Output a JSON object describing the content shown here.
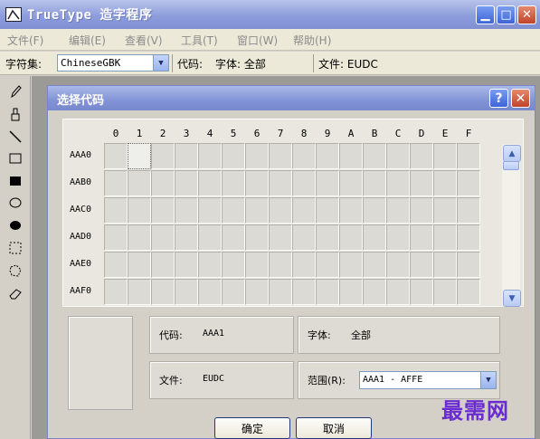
{
  "window": {
    "title": "TrueType 造字程序"
  },
  "menu": [
    "文件(F)",
    "编辑(E)",
    "查看(V)",
    "工具(T)",
    "窗口(W)",
    "帮助(H)"
  ],
  "toolbar": {
    "charset_label": "字符集:",
    "charset_value": "ChineseGBK",
    "code_label": "代码:",
    "font_label": "字体: 全部",
    "file_label": "文件: EUDC"
  },
  "tools": [
    "pencil-icon",
    "brush-icon",
    "line-icon",
    "rectangle-icon",
    "filled-rectangle-icon",
    "ellipse-icon",
    "filled-ellipse-icon",
    "rect-select-icon",
    "freeform-select-icon",
    "eraser-icon"
  ],
  "dialog": {
    "title": "选择代码",
    "columns": [
      "0",
      "1",
      "2",
      "3",
      "4",
      "5",
      "6",
      "7",
      "8",
      "9",
      "A",
      "B",
      "C",
      "D",
      "E",
      "F"
    ],
    "rows": [
      "AAA0",
      "AAB0",
      "AAC0",
      "AAD0",
      "AAE0",
      "AAF0"
    ],
    "selected_cell": "AAA1",
    "code_label": "代码:",
    "code_value": "AAA1",
    "font_label": "字体:",
    "font_value": "全部",
    "file_label": "文件:",
    "file_value": "EUDC",
    "range_label": "范围(R):",
    "range_value": "AAA1 - AFFE",
    "ok_label": "确定",
    "cancel_label": "取消"
  },
  "watermark": "最需网",
  "colors": {
    "title_bar": "#8d9ddc",
    "window_bg": "#d4d0c8",
    "watermark": "#6a2bd0",
    "close_button": "#c0432a"
  }
}
